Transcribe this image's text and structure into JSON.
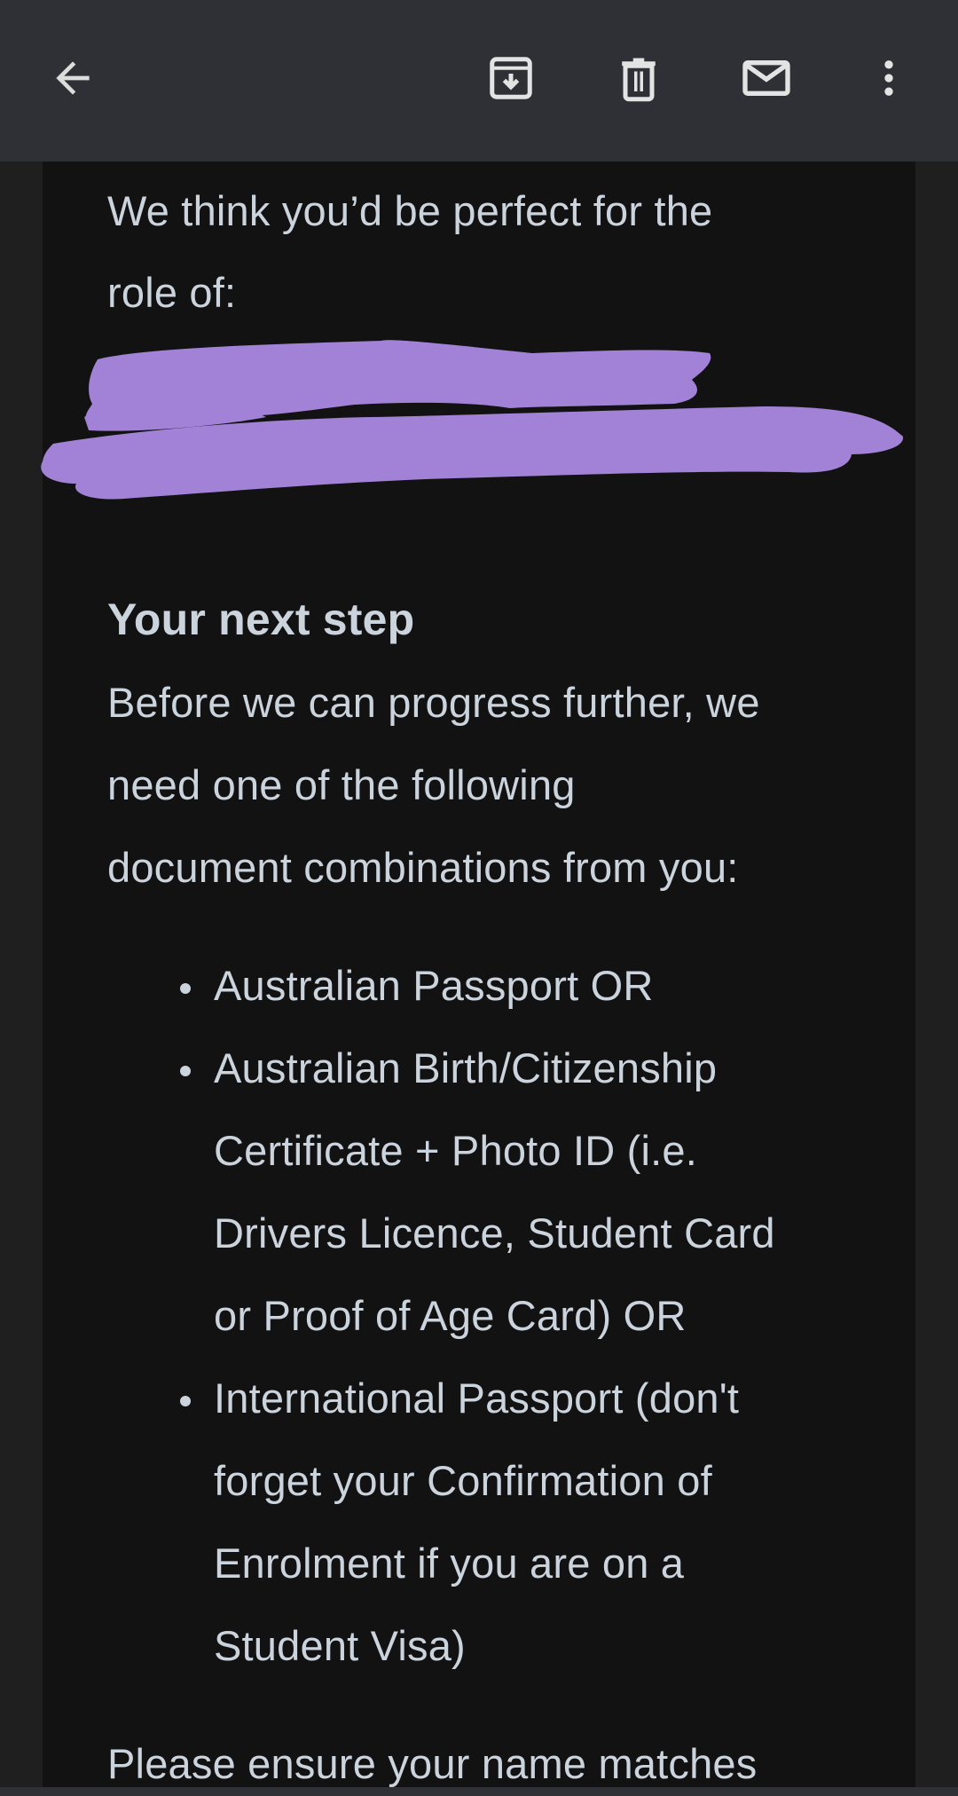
{
  "toolbar": {
    "back": {
      "icon": "arrow-back-icon",
      "label": "Back"
    },
    "actions": [
      {
        "icon": "archive-icon",
        "label": "Archive"
      },
      {
        "icon": "delete-icon",
        "label": "Delete"
      },
      {
        "icon": "mark-unread-icon",
        "label": "Mark as unread"
      },
      {
        "icon": "more-vert-icon",
        "label": "More options"
      }
    ]
  },
  "email": {
    "intro_lines": [
      "We think you’d be perfect for the",
      "role of:"
    ],
    "role_redacted": true,
    "redaction_color": "#a182d6",
    "heading": "Your next step",
    "body_lines": [
      "Before we can progress further, we",
      "need one of the following",
      "document combinations from you:"
    ],
    "list": [
      {
        "lines": [
          "Australian Passport OR"
        ]
      },
      {
        "lines": [
          "Australian Birth/Citizenship",
          "Certificate + Photo ID (i.e.",
          "Drivers Licence, Student Card",
          "or Proof of Age Card) OR"
        ]
      },
      {
        "lines": [
          "International Passport (don't",
          "forget your Confirmation of",
          "Enrolment if you are on a",
          "Student Visa)"
        ]
      }
    ],
    "footer_line": "Please ensure your name matches"
  },
  "colors": {
    "toolbar_bg": "#2f3035",
    "page_bg": "#1f1f1f",
    "panel_bg": "#121212",
    "text": "#cbd3dc",
    "icon": "#e3e3e3"
  }
}
